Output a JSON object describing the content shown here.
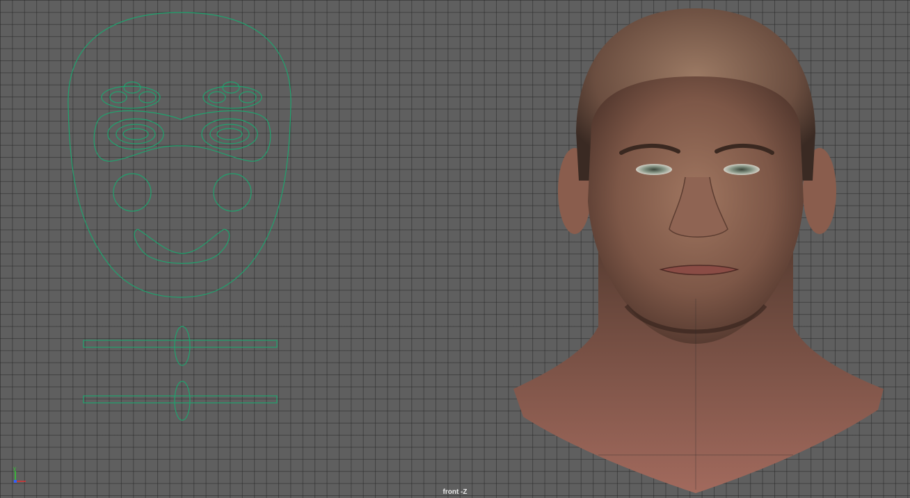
{
  "viewport": {
    "camera_label": "front -Z",
    "grid_color": "#2a2a2a",
    "background_color": "#5f5f5f"
  },
  "rig_controls": {
    "curve_color": "#1fa36e",
    "shapes": [
      "face-outline",
      "brow-ctrl-left",
      "brow-ctrl-right",
      "eye-ctrl-left",
      "eye-ctrl-right",
      "cheek-ctrl-left",
      "cheek-ctrl-right",
      "mouth-ctrl",
      "slider-ctrl-1",
      "slider-ctrl-2"
    ]
  },
  "axis_gizmo": {
    "y_label": "y",
    "x_color": "#e03030",
    "y_color": "#30d030",
    "z_color": "#3060ff"
  },
  "head_model": {
    "description_icon": "head-model-render"
  }
}
